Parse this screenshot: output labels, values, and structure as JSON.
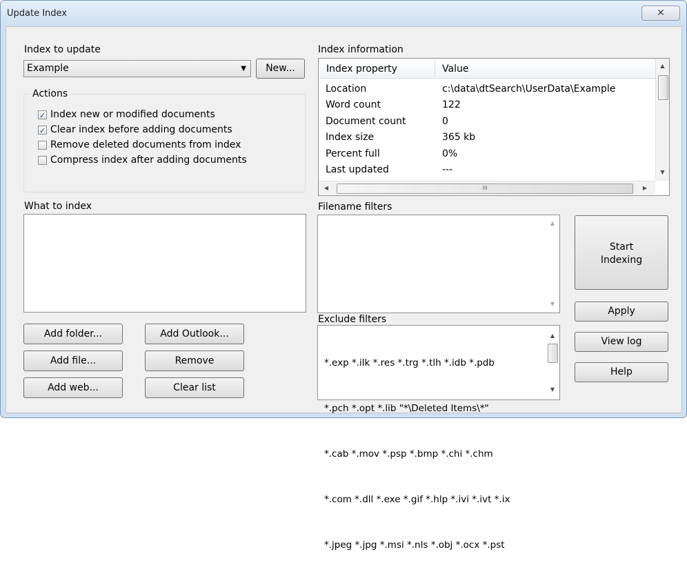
{
  "window": {
    "title": "Update Index",
    "close_glyph": "✕"
  },
  "index_to_update": {
    "label": "Index to update",
    "selected": "Example",
    "new_button": "New..."
  },
  "actions": {
    "label": "Actions",
    "items": [
      {
        "label": "Index new or modified documents",
        "checked": true
      },
      {
        "label": "Clear index before adding documents",
        "checked": true
      },
      {
        "label": "Remove deleted documents from index",
        "checked": false
      },
      {
        "label": "Compress index after adding documents",
        "checked": false
      }
    ]
  },
  "index_info": {
    "label": "Index information",
    "columns": [
      "Index property",
      "Value"
    ],
    "rows": [
      {
        "property": "Location",
        "value": "c:\\data\\dtSearch\\UserData\\Example"
      },
      {
        "property": "Word count",
        "value": "122"
      },
      {
        "property": "Document count",
        "value": "0"
      },
      {
        "property": "Index size",
        "value": "365 kb"
      },
      {
        "property": "Percent full",
        "value": "0%"
      },
      {
        "property": "Last updated",
        "value": "---"
      }
    ],
    "hscroll_grip": "III"
  },
  "what_to_index": {
    "label": "What to index"
  },
  "filename_filters": {
    "label": "Filename filters"
  },
  "exclude_filters": {
    "label": "Exclude filters",
    "lines": [
      "*.exp *.ilk *.res *.trg *.tlh *.idb *.pdb",
      "*.pch *.opt *.lib \"*\\Deleted Items\\*\"",
      "*.cab *.mov *.psp *.bmp *.chi *.chm",
      "*.com *.dll *.exe *.gif *.hlp *.ivi *.ivt *.ix",
      "*.jpeg *.jpg *.msi *.nls *.obj *.ocx *.pst"
    ]
  },
  "buttons": {
    "add_folder": "Add folder...",
    "add_outlook": "Add Outlook...",
    "add_file": "Add file...",
    "remove": "Remove",
    "add_web": "Add web...",
    "clear_list": "Clear list",
    "start_indexing_line1": "Start",
    "start_indexing_line2": "Indexing",
    "apply": "Apply",
    "view_log": "View log",
    "help": "Help"
  },
  "icons": {
    "dropdown": "▼",
    "scroll_up": "▲",
    "scroll_down": "▼",
    "scroll_left": "◀",
    "scroll_right": "▶",
    "checkmark": "✓"
  }
}
